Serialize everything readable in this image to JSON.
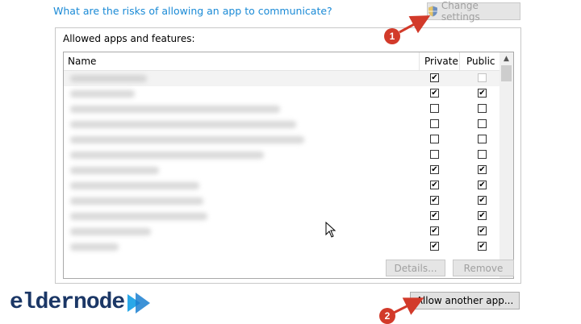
{
  "header": {
    "risk_link": "What are the risks of allowing an app to communicate?",
    "change_settings": "Change settings"
  },
  "groupbox": {
    "title": "Allowed apps and features:"
  },
  "table": {
    "headers": {
      "name": "Name",
      "private": "Private",
      "public": "Public"
    },
    "rows": [
      {
        "private": true,
        "public": false
      },
      {
        "private": true,
        "public": true
      },
      {
        "private": false,
        "public": false
      },
      {
        "private": false,
        "public": false
      },
      {
        "private": false,
        "public": false
      },
      {
        "private": false,
        "public": false
      },
      {
        "private": true,
        "public": true
      },
      {
        "private": true,
        "public": true
      },
      {
        "private": true,
        "public": true
      },
      {
        "private": true,
        "public": true
      },
      {
        "private": true,
        "public": true
      },
      {
        "private": true,
        "public": true
      }
    ]
  },
  "buttons": {
    "details": "Details...",
    "remove": "Remove",
    "allow_another": "Allow another app..."
  },
  "annotations": {
    "step1": "1",
    "step2": "2"
  },
  "logo": {
    "text": "eldernode"
  },
  "colors": {
    "link": "#1a8ad6",
    "badge": "#d23a2a",
    "logo": "#1b3766",
    "arrow": "#d23a2a"
  }
}
